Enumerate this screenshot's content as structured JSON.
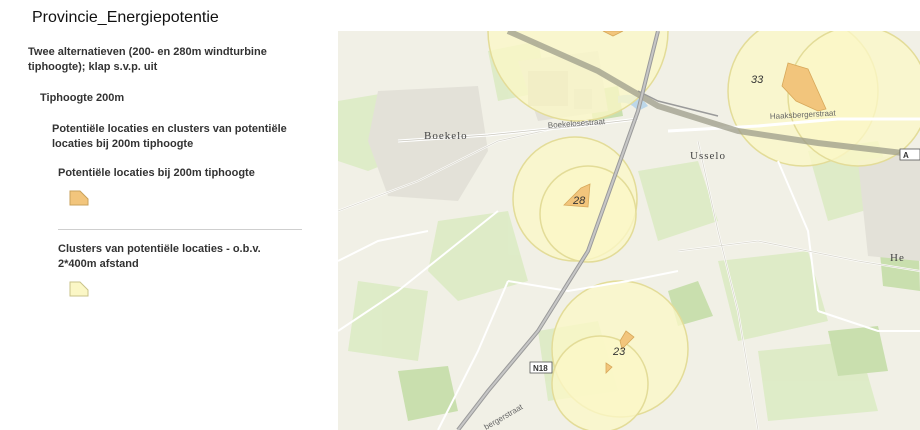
{
  "title": "Provincie_Energiepotentie",
  "legend": {
    "group_title": "Twee alternatieven (200- en 280m windturbine tiphoogte); klap s.v.p. uit",
    "sub_title": "Tiphoogte 200m",
    "layer_title": "Potentiële locaties en clusters van potentiële locaties bij 200m tiphoogte",
    "items": [
      {
        "label": "Potentiële locaties bij 200m tiphoogte",
        "color": "#f2c57c"
      },
      {
        "label": "Clusters van potentiële locaties - o.b.v. 2*400m afstand",
        "color": "#fbf7c6"
      }
    ]
  },
  "map": {
    "places": [
      "Boekelo",
      "Usselo",
      "He"
    ],
    "roads": [
      "Boekelosestraat",
      "Haaksbergerstraat",
      "bergerstraat"
    ],
    "road_shields": [
      "N18",
      "A"
    ],
    "clusters": [
      "33",
      "28",
      "23"
    ],
    "colors": {
      "location": "#f2c57c",
      "cluster": "#fbf7c6",
      "cluster_outline": "#e3dc98"
    }
  }
}
